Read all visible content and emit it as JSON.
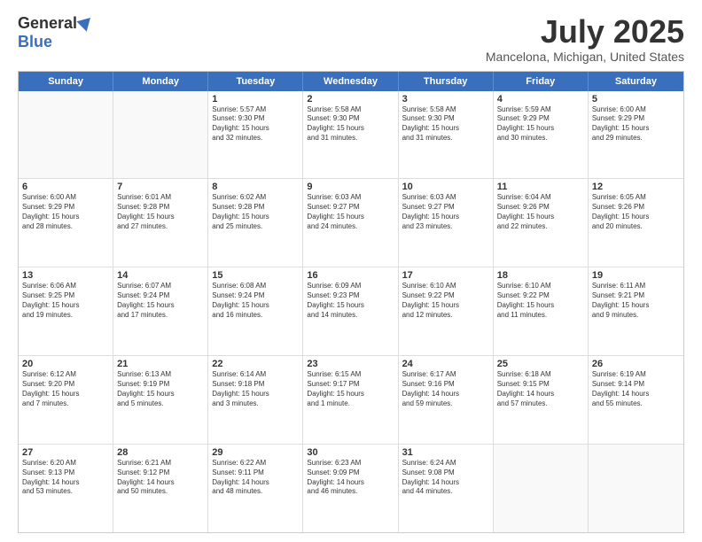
{
  "header": {
    "logo_general": "General",
    "logo_blue": "Blue",
    "title": "July 2025",
    "location": "Mancelona, Michigan, United States"
  },
  "days_of_week": [
    "Sunday",
    "Monday",
    "Tuesday",
    "Wednesday",
    "Thursday",
    "Friday",
    "Saturday"
  ],
  "weeks": [
    [
      {
        "day": "",
        "empty": true
      },
      {
        "day": "",
        "empty": true
      },
      {
        "day": "1",
        "line1": "Sunrise: 5:57 AM",
        "line2": "Sunset: 9:30 PM",
        "line3": "Daylight: 15 hours",
        "line4": "and 32 minutes."
      },
      {
        "day": "2",
        "line1": "Sunrise: 5:58 AM",
        "line2": "Sunset: 9:30 PM",
        "line3": "Daylight: 15 hours",
        "line4": "and 31 minutes."
      },
      {
        "day": "3",
        "line1": "Sunrise: 5:58 AM",
        "line2": "Sunset: 9:30 PM",
        "line3": "Daylight: 15 hours",
        "line4": "and 31 minutes."
      },
      {
        "day": "4",
        "line1": "Sunrise: 5:59 AM",
        "line2": "Sunset: 9:29 PM",
        "line3": "Daylight: 15 hours",
        "line4": "and 30 minutes."
      },
      {
        "day": "5",
        "line1": "Sunrise: 6:00 AM",
        "line2": "Sunset: 9:29 PM",
        "line3": "Daylight: 15 hours",
        "line4": "and 29 minutes."
      }
    ],
    [
      {
        "day": "6",
        "line1": "Sunrise: 6:00 AM",
        "line2": "Sunset: 9:29 PM",
        "line3": "Daylight: 15 hours",
        "line4": "and 28 minutes."
      },
      {
        "day": "7",
        "line1": "Sunrise: 6:01 AM",
        "line2": "Sunset: 9:28 PM",
        "line3": "Daylight: 15 hours",
        "line4": "and 27 minutes."
      },
      {
        "day": "8",
        "line1": "Sunrise: 6:02 AM",
        "line2": "Sunset: 9:28 PM",
        "line3": "Daylight: 15 hours",
        "line4": "and 25 minutes."
      },
      {
        "day": "9",
        "line1": "Sunrise: 6:03 AM",
        "line2": "Sunset: 9:27 PM",
        "line3": "Daylight: 15 hours",
        "line4": "and 24 minutes."
      },
      {
        "day": "10",
        "line1": "Sunrise: 6:03 AM",
        "line2": "Sunset: 9:27 PM",
        "line3": "Daylight: 15 hours",
        "line4": "and 23 minutes."
      },
      {
        "day": "11",
        "line1": "Sunrise: 6:04 AM",
        "line2": "Sunset: 9:26 PM",
        "line3": "Daylight: 15 hours",
        "line4": "and 22 minutes."
      },
      {
        "day": "12",
        "line1": "Sunrise: 6:05 AM",
        "line2": "Sunset: 9:26 PM",
        "line3": "Daylight: 15 hours",
        "line4": "and 20 minutes."
      }
    ],
    [
      {
        "day": "13",
        "line1": "Sunrise: 6:06 AM",
        "line2": "Sunset: 9:25 PM",
        "line3": "Daylight: 15 hours",
        "line4": "and 19 minutes."
      },
      {
        "day": "14",
        "line1": "Sunrise: 6:07 AM",
        "line2": "Sunset: 9:24 PM",
        "line3": "Daylight: 15 hours",
        "line4": "and 17 minutes."
      },
      {
        "day": "15",
        "line1": "Sunrise: 6:08 AM",
        "line2": "Sunset: 9:24 PM",
        "line3": "Daylight: 15 hours",
        "line4": "and 16 minutes."
      },
      {
        "day": "16",
        "line1": "Sunrise: 6:09 AM",
        "line2": "Sunset: 9:23 PM",
        "line3": "Daylight: 15 hours",
        "line4": "and 14 minutes."
      },
      {
        "day": "17",
        "line1": "Sunrise: 6:10 AM",
        "line2": "Sunset: 9:22 PM",
        "line3": "Daylight: 15 hours",
        "line4": "and 12 minutes."
      },
      {
        "day": "18",
        "line1": "Sunrise: 6:10 AM",
        "line2": "Sunset: 9:22 PM",
        "line3": "Daylight: 15 hours",
        "line4": "and 11 minutes."
      },
      {
        "day": "19",
        "line1": "Sunrise: 6:11 AM",
        "line2": "Sunset: 9:21 PM",
        "line3": "Daylight: 15 hours",
        "line4": "and 9 minutes."
      }
    ],
    [
      {
        "day": "20",
        "line1": "Sunrise: 6:12 AM",
        "line2": "Sunset: 9:20 PM",
        "line3": "Daylight: 15 hours",
        "line4": "and 7 minutes."
      },
      {
        "day": "21",
        "line1": "Sunrise: 6:13 AM",
        "line2": "Sunset: 9:19 PM",
        "line3": "Daylight: 15 hours",
        "line4": "and 5 minutes."
      },
      {
        "day": "22",
        "line1": "Sunrise: 6:14 AM",
        "line2": "Sunset: 9:18 PM",
        "line3": "Daylight: 15 hours",
        "line4": "and 3 minutes."
      },
      {
        "day": "23",
        "line1": "Sunrise: 6:15 AM",
        "line2": "Sunset: 9:17 PM",
        "line3": "Daylight: 15 hours",
        "line4": "and 1 minute."
      },
      {
        "day": "24",
        "line1": "Sunrise: 6:17 AM",
        "line2": "Sunset: 9:16 PM",
        "line3": "Daylight: 14 hours",
        "line4": "and 59 minutes."
      },
      {
        "day": "25",
        "line1": "Sunrise: 6:18 AM",
        "line2": "Sunset: 9:15 PM",
        "line3": "Daylight: 14 hours",
        "line4": "and 57 minutes."
      },
      {
        "day": "26",
        "line1": "Sunrise: 6:19 AM",
        "line2": "Sunset: 9:14 PM",
        "line3": "Daylight: 14 hours",
        "line4": "and 55 minutes."
      }
    ],
    [
      {
        "day": "27",
        "line1": "Sunrise: 6:20 AM",
        "line2": "Sunset: 9:13 PM",
        "line3": "Daylight: 14 hours",
        "line4": "and 53 minutes."
      },
      {
        "day": "28",
        "line1": "Sunrise: 6:21 AM",
        "line2": "Sunset: 9:12 PM",
        "line3": "Daylight: 14 hours",
        "line4": "and 50 minutes."
      },
      {
        "day": "29",
        "line1": "Sunrise: 6:22 AM",
        "line2": "Sunset: 9:11 PM",
        "line3": "Daylight: 14 hours",
        "line4": "and 48 minutes."
      },
      {
        "day": "30",
        "line1": "Sunrise: 6:23 AM",
        "line2": "Sunset: 9:09 PM",
        "line3": "Daylight: 14 hours",
        "line4": "and 46 minutes."
      },
      {
        "day": "31",
        "line1": "Sunrise: 6:24 AM",
        "line2": "Sunset: 9:08 PM",
        "line3": "Daylight: 14 hours",
        "line4": "and 44 minutes."
      },
      {
        "day": "",
        "empty": true
      },
      {
        "day": "",
        "empty": true
      }
    ]
  ]
}
